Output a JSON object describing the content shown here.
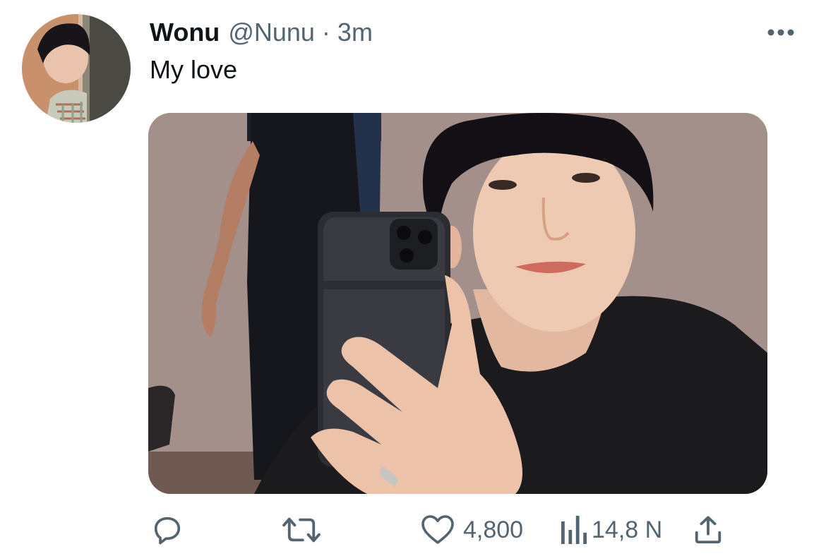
{
  "tweet": {
    "author": {
      "display_name": "Wonu",
      "handle": "@Nunu",
      "avatar_icon": "profile-photo"
    },
    "separator": "·",
    "timestamp": "3m",
    "text": "My love",
    "more_icon": "more-horizontal-icon",
    "media": {
      "kind": "photo"
    },
    "actions": {
      "reply": {
        "icon": "reply-icon",
        "count": ""
      },
      "retweet": {
        "icon": "retweet-icon",
        "count": ""
      },
      "like": {
        "icon": "heart-icon",
        "count": "4,800"
      },
      "views": {
        "icon": "views-icon",
        "count": "14,8 N"
      },
      "share": {
        "icon": "share-icon"
      }
    }
  },
  "colors": {
    "text_primary": "#0f1419",
    "text_secondary": "#536471",
    "background": "#ffffff"
  }
}
